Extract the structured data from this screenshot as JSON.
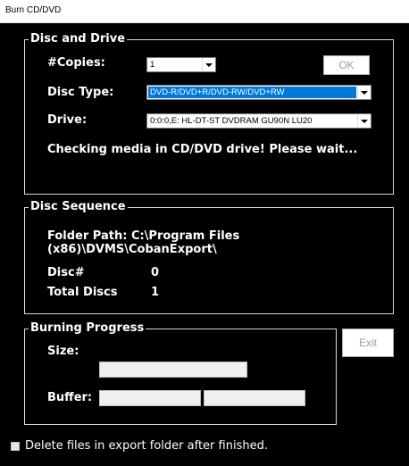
{
  "window": {
    "title": "Burn CD/DVD"
  },
  "disc_and_drive": {
    "legend": "Disc and Drive",
    "copies_label": "#Copies:",
    "copies_value": "1",
    "ok_label": "OK",
    "disc_type_label": "Disc Type:",
    "disc_type_value": "DVD-R/DVD+R/DVD-RW/DVD+RW",
    "drive_label": "Drive:",
    "drive_value": "0:0:0,E: HL-DT-ST DVDRAM GU90N   LU20",
    "status": "Checking media in CD/DVD drive! Please wait..."
  },
  "disc_sequence": {
    "legend": "Disc Sequence",
    "folder_path_line1": "Folder Path: C:\\Program Files",
    "folder_path_line2": "(x86)\\DVMS\\CobanExport\\",
    "disc_label": "Disc#",
    "disc_value": "0",
    "total_label": "Total Discs",
    "total_value": "1"
  },
  "burning_progress": {
    "legend": "Burning Progress",
    "size_label": "Size:",
    "buffer_label": "Buffer:",
    "size_progress": 0,
    "buffer_progress": 0
  },
  "exit_label": "Exit",
  "delete_files": {
    "label": "Delete files in export folder after finished.",
    "checked": false
  }
}
